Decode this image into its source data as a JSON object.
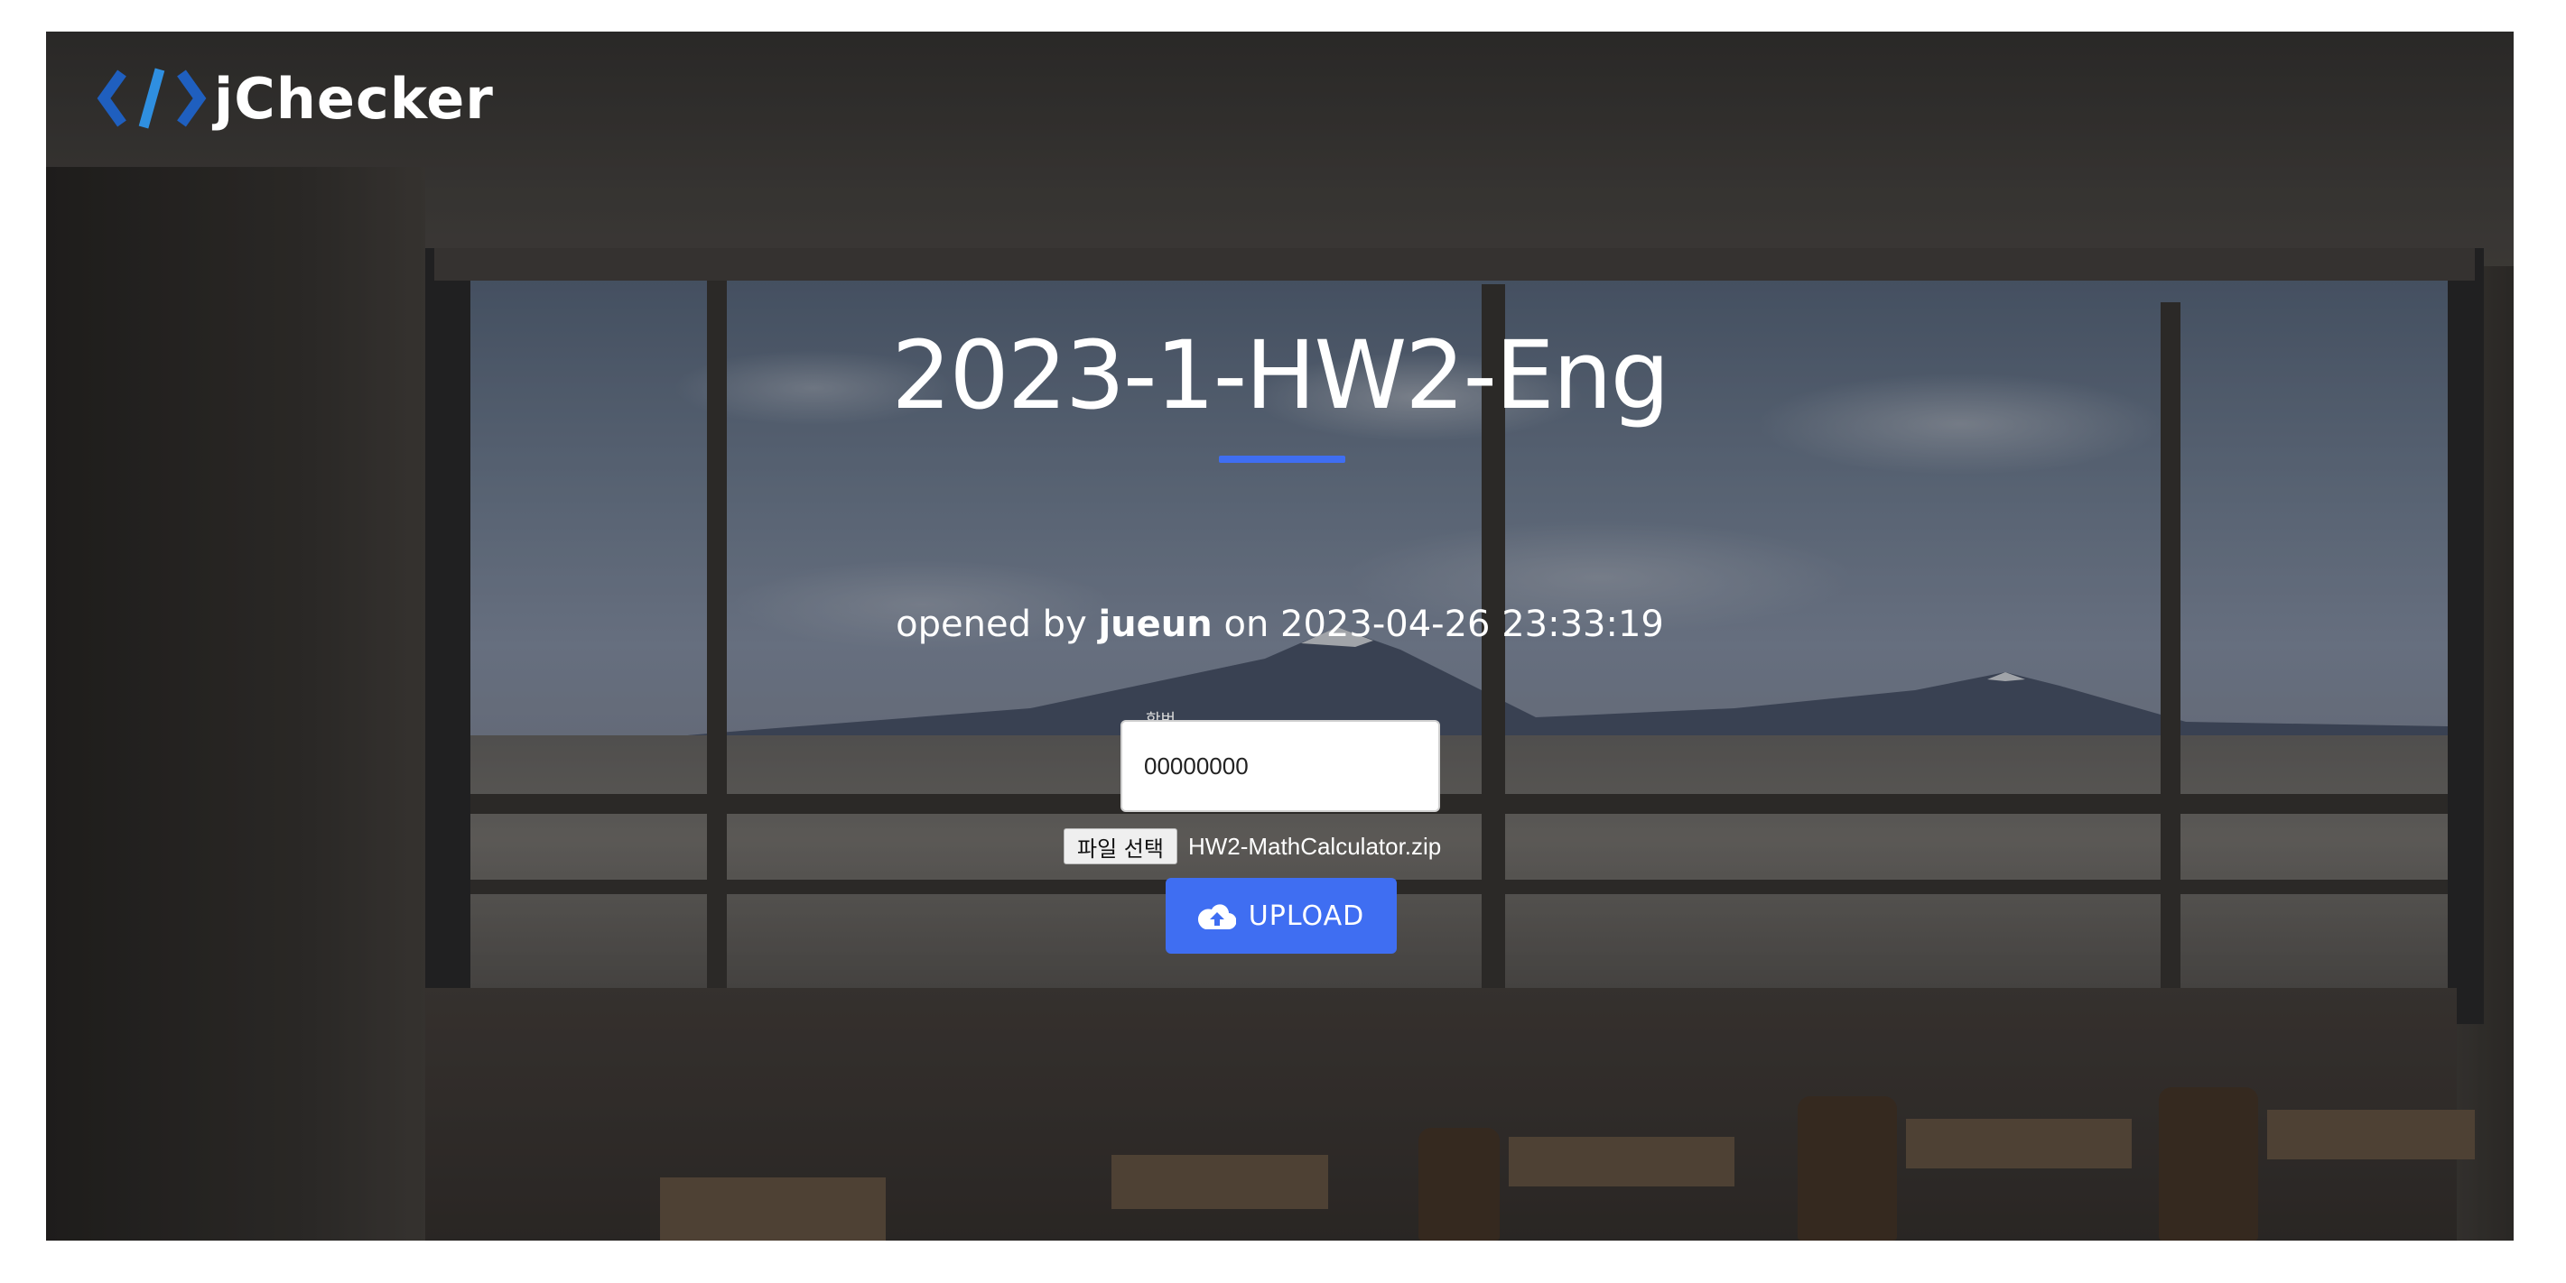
{
  "brand": {
    "name": "jChecker",
    "logo_icon": "code-brackets-icon",
    "logo_colors": [
      "#1f5fbf",
      "#2f8fe0"
    ]
  },
  "assignment": {
    "title": "2023-1-HW2-Eng",
    "opened_prefix": "opened by",
    "author": "jueun",
    "on_word": "on",
    "opened_at": "2023-04-26 23:33:19"
  },
  "form": {
    "id_label": "학번",
    "id_value": "00000000",
    "file_button_label": "파일 선택",
    "file_name": "HW2-MathCalculator.zip",
    "upload_label": "UPLOAD",
    "upload_icon": "cloud-upload-icon"
  },
  "colors": {
    "accent": "#3f6ef2",
    "text": "#ffffff"
  }
}
